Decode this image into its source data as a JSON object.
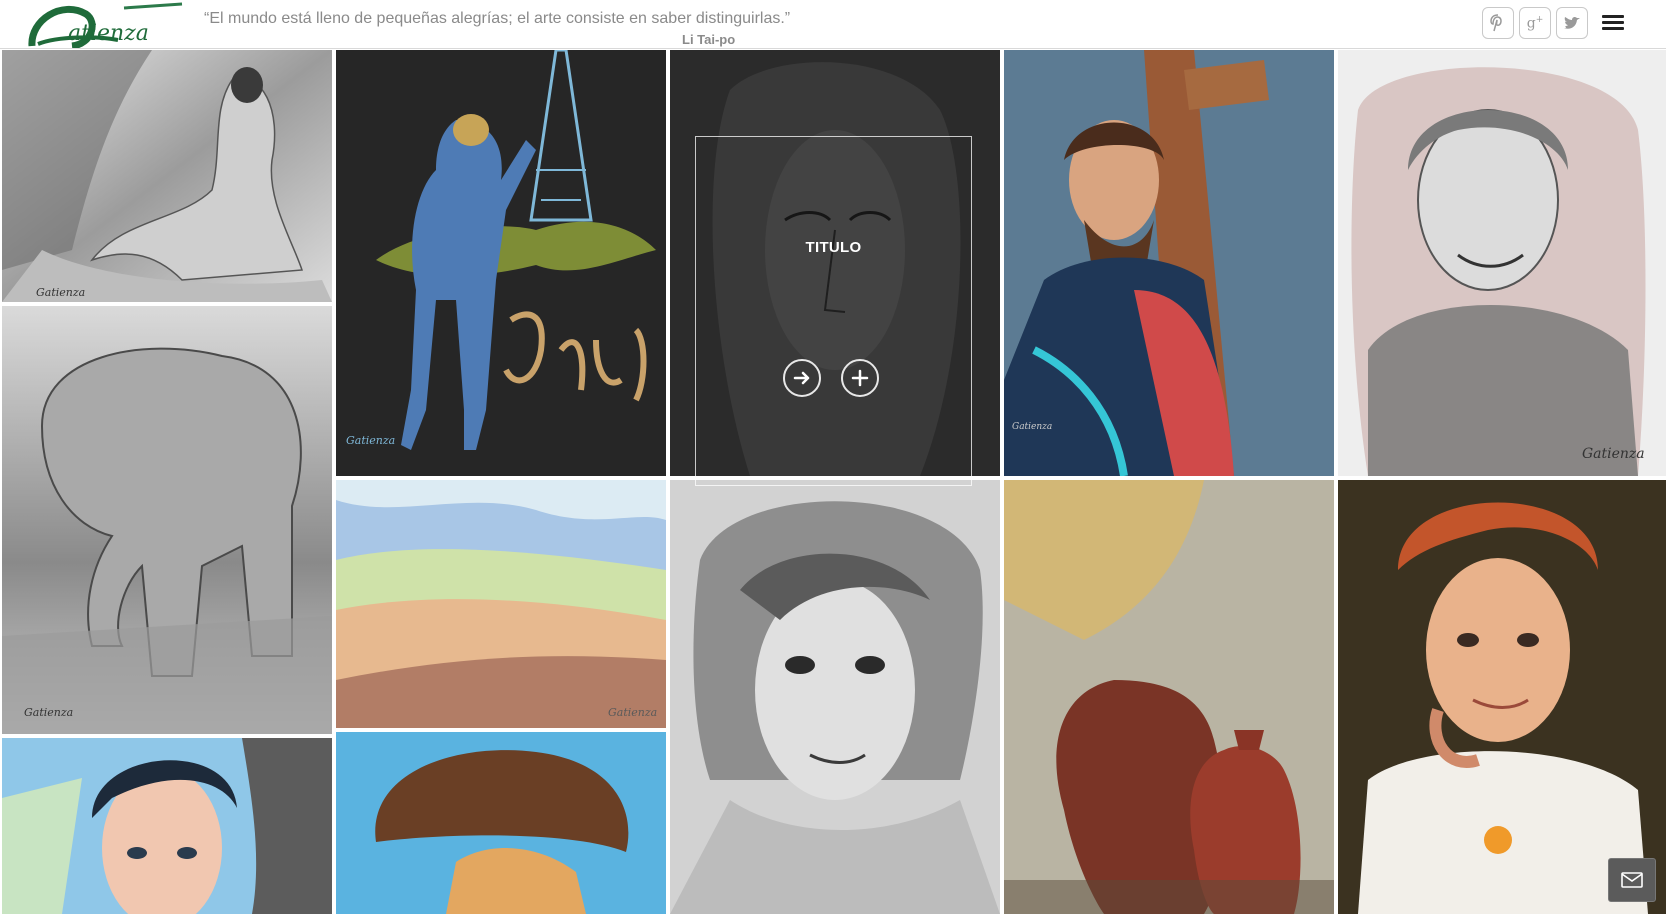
{
  "header": {
    "logo_text": "atienza",
    "quote": "“El mundo está lleno de pequeñas alegrías; el arte consiste en saber distinguirlas.”",
    "quote_author": "Li Tai-po",
    "social": [
      {
        "name": "pinterest-icon",
        "glyph": "P"
      },
      {
        "name": "google-plus-icon",
        "glyph": "g+"
      },
      {
        "name": "twitter-icon",
        "glyph": "t"
      }
    ],
    "menu_icon": "hamburger-menu-icon"
  },
  "gallery": {
    "tiles": [
      {
        "name": "artwork-nude-back",
        "signature": "Gatienza"
      },
      {
        "name": "artwork-elephant",
        "signature": "Gatienza"
      },
      {
        "name": "artwork-woman-portrait-blue",
        "signature": ""
      },
      {
        "name": "artwork-paris-eiffel",
        "signature": "Gatienza",
        "text": "Paris"
      },
      {
        "name": "artwork-landscape-fields",
        "signature": "Gatienza"
      },
      {
        "name": "artwork-woman-hat",
        "signature": ""
      },
      {
        "name": "artwork-pieta-face",
        "signature": ""
      },
      {
        "name": "artwork-girl-charcoal",
        "signature": ""
      },
      {
        "name": "artwork-christ-cross",
        "signature": "Gatienza"
      },
      {
        "name": "artwork-still-life-jugs",
        "signature": ""
      },
      {
        "name": "artwork-elderly-woman",
        "signature": "Gatienza"
      },
      {
        "name": "artwork-redhead-woman",
        "signature": ""
      }
    ],
    "hover_overlay": {
      "title": "TITULO",
      "buttons": [
        {
          "name": "open-link-button",
          "icon": "arrow-right-icon"
        },
        {
          "name": "zoom-button",
          "icon": "plus-icon"
        }
      ]
    }
  },
  "contact": {
    "icon": "envelope-icon"
  },
  "colors": {
    "brand_green": "#1f6b3a",
    "header_bg": "#ffffff",
    "text_gray": "#8a8a8a"
  }
}
